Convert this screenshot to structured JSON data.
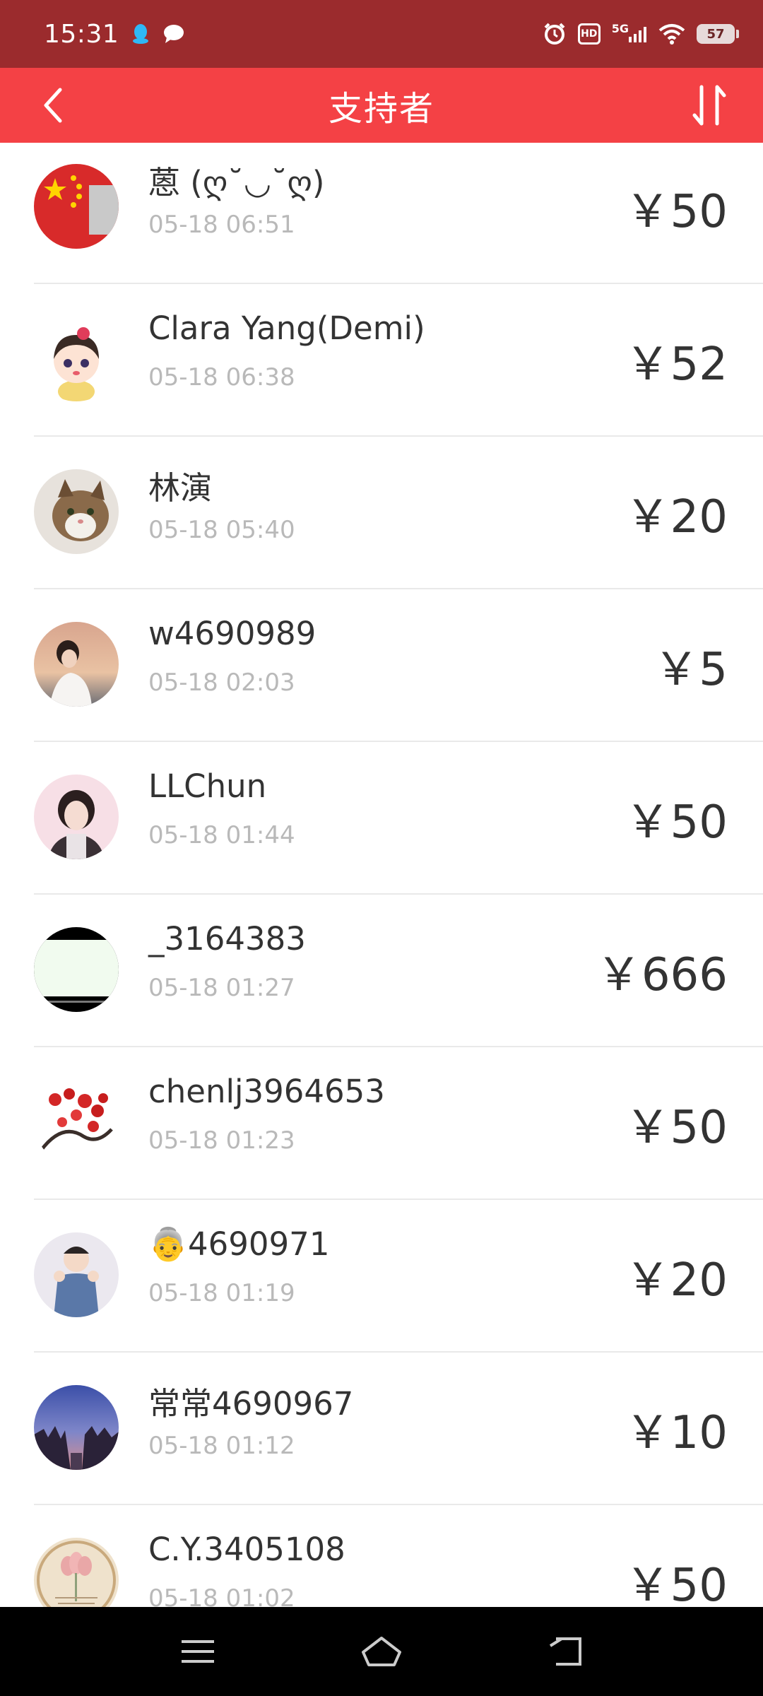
{
  "status_bar": {
    "time": "15:31",
    "battery": "57",
    "network": "5G",
    "hd": "HD",
    "icons": [
      "qq-icon",
      "message-icon",
      "alarm-icon",
      "hd-icon",
      "signal-icon",
      "wifi-icon",
      "battery-icon"
    ]
  },
  "header": {
    "title": "支持者",
    "back_icon": "chevron-left-icon",
    "sort_icon": "sort-icon",
    "background": "#f44145"
  },
  "supporters": [
    {
      "name": "蒽 (ღ˘◡˘ღ)",
      "time": "05-18 06:51",
      "amount": "￥50"
    },
    {
      "name": "Clara Yang(Demi)",
      "time": "05-18 06:38",
      "amount": "￥52"
    },
    {
      "name": "林演",
      "time": "05-18 05:40",
      "amount": "￥20"
    },
    {
      "name": "w4690989",
      "time": "05-18 02:03",
      "amount": "￥5"
    },
    {
      "name": "LLChun",
      "time": "05-18 01:44",
      "amount": "￥50"
    },
    {
      "name": "_3164383",
      "time": "05-18 01:27",
      "amount": "￥666"
    },
    {
      "name": "chenlj3964653",
      "time": "05-18 01:23",
      "amount": "￥50"
    },
    {
      "name": "👵4690971",
      "time": "05-18 01:19",
      "amount": "￥20"
    },
    {
      "name": "常常4690967",
      "time": "05-18 01:12",
      "amount": "￥10"
    },
    {
      "name": "C.Y.3405108",
      "time": "05-18 01:02",
      "amount": "￥50"
    }
  ],
  "nav": {
    "icons": [
      "menu-icon",
      "home-icon",
      "back-icon"
    ]
  }
}
